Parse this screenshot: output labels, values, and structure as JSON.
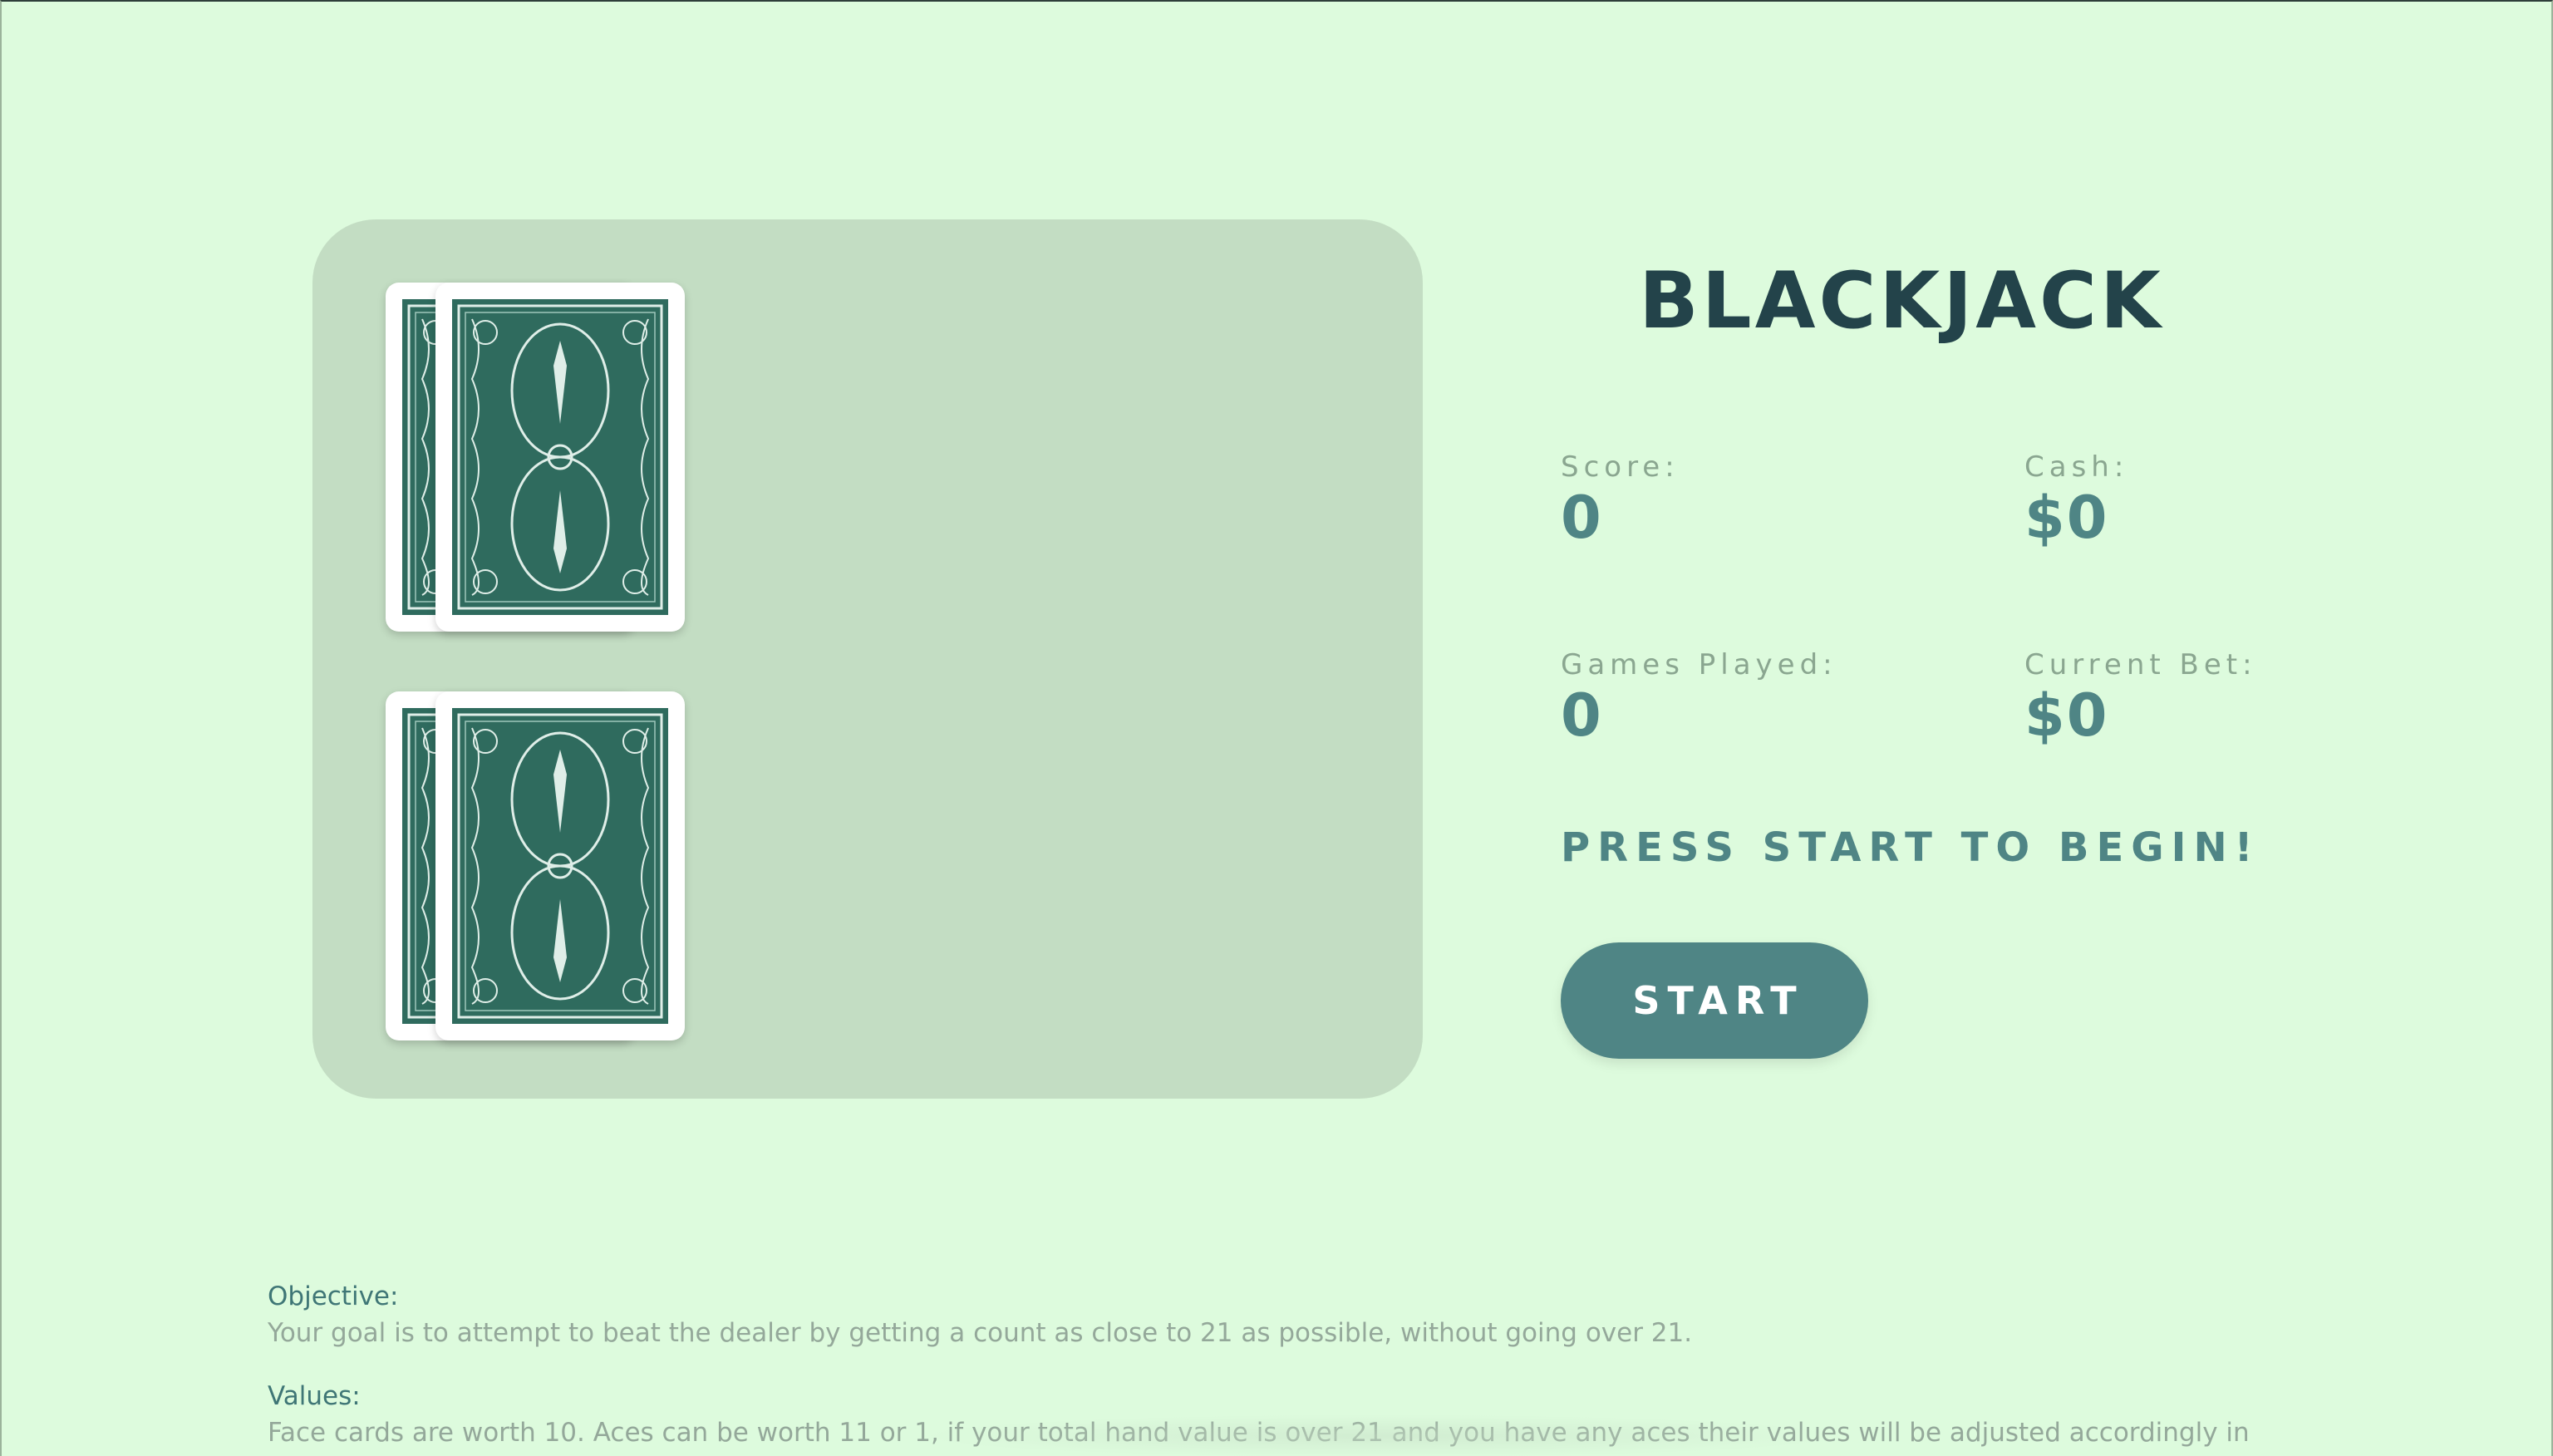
{
  "header": {
    "title": "BLACKJACK"
  },
  "stats": {
    "score_label": "Score:",
    "score_value": "0",
    "cash_label": "Cash:",
    "cash_value": "$0",
    "games_label": "Games Played:",
    "games_value": "0",
    "bet_label": "Current Bet:",
    "bet_value": "$0"
  },
  "status": {
    "message": "PRESS START TO BEGIN!"
  },
  "controls": {
    "start_label": "START"
  },
  "table": {
    "dealer_cards": [
      "card-back",
      "card-back"
    ],
    "player_cards": [
      "card-back",
      "card-back"
    ]
  },
  "instructions": {
    "objective_heading": "Objective:",
    "objective_text": "Your goal is to attempt to beat the dealer by getting a count as close to 21 as possible, without going over 21.",
    "values_heading": "Values:",
    "values_text": "Face cards are worth 10. Aces can be worth 11 or 1, if your total hand value is over 21 and you have any aces their values will be adjusted accordingly in"
  },
  "colors": {
    "background": "#ddfbdd",
    "table": "#c3ddc3",
    "accent": "#4f8585",
    "title": "#23434a",
    "card_back": "#2f6b5e"
  }
}
